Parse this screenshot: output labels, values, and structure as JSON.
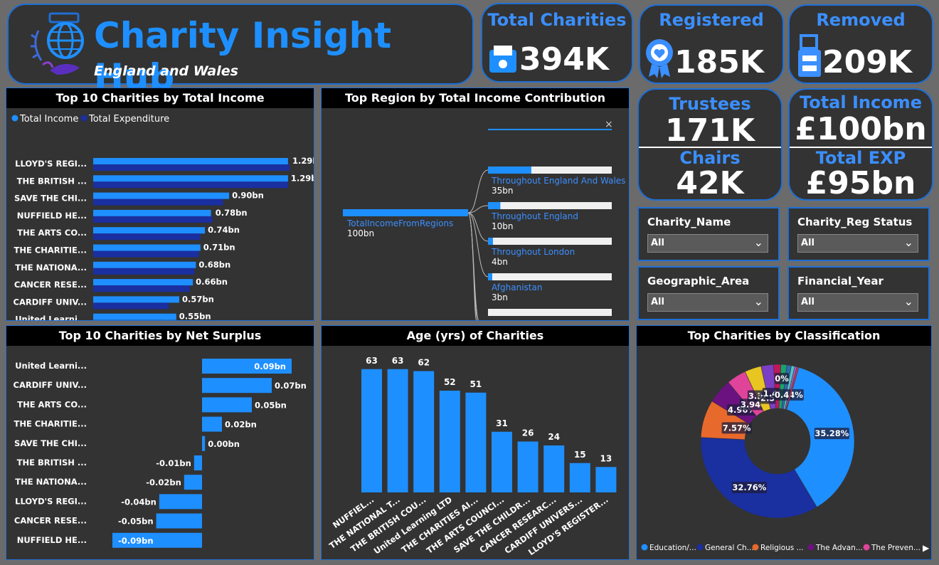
{
  "header": {
    "title": "Charity Insight Hub",
    "subtitle": "England and Wales"
  },
  "kpis": {
    "total_charities": {
      "label": "Total Charities",
      "value": "394K"
    },
    "registered": {
      "label": "Registered",
      "value": "185K"
    },
    "removed": {
      "label": "Removed",
      "value": "209K"
    },
    "trustees": {
      "label": "Trustees",
      "value": "171K"
    },
    "chairs": {
      "label": "Chairs",
      "value": "42K"
    },
    "total_income": {
      "label": "Total Income",
      "value": "£100bn"
    },
    "total_exp": {
      "label": "Total EXP",
      "value": "£95bn"
    }
  },
  "slicers": [
    {
      "label": "Charity_Name",
      "value": "All"
    },
    {
      "label": "Charity_Reg Status",
      "value": "All"
    },
    {
      "label": "Geographic_Area",
      "value": "All"
    },
    {
      "label": "Financial_Year",
      "value": "All"
    }
  ],
  "panels": {
    "income": "Top 10 Charities by Total Income",
    "region": "Top Region by Total Income Contribution",
    "surplus": "Top 10 Charities by Net Surplus",
    "age": "Age (yrs) of Charities",
    "classification": "Top Charities by Classification"
  },
  "colors": {
    "accent": "#1e8fff",
    "navy": "#1a2fa0",
    "panel": "#333333"
  },
  "chart_data": [
    {
      "type": "bar",
      "title": "Top 10 Charities by Total Income",
      "legend": "top-left",
      "categories": [
        "LLOYD'S REGI...",
        "THE BRITISH ...",
        "SAVE THE CHI...",
        "NUFFIELD HE...",
        "THE ARTS CO...",
        "THE CHARITIE...",
        "THE NATIONA...",
        "CANCER RESE...",
        "CARDIFF UNIV...",
        "United Learni..."
      ],
      "series": [
        {
          "name": "Total Income",
          "values": [
            1.29,
            1.29,
            0.9,
            0.78,
            0.74,
            0.71,
            0.68,
            0.66,
            0.57,
            0.55
          ],
          "labels": [
            "1.29bn",
            "1.29bn",
            "0.90bn",
            "0.78bn",
            "0.74bn",
            "0.71bn",
            "0.68bn",
            "0.66bn",
            "0.57bn",
            "0.55bn"
          ]
        },
        {
          "name": "Total Expenditure",
          "values": [
            1.3,
            1.29,
            0.86,
            0.79,
            0.71,
            0.7,
            0.67,
            0.64,
            0.5,
            0.46
          ]
        }
      ]
    },
    {
      "type": "tree",
      "title": "Top Region by Total Income Contribution",
      "root": {
        "name": "TotalIncomeFromRegions",
        "value": 100,
        "label": "100bn"
      },
      "nodes": [
        {
          "name": "Throughout England And Wales",
          "value": 35,
          "label": "35bn"
        },
        {
          "name": "Throughout England",
          "value": 10,
          "label": "10bn"
        },
        {
          "name": "Throughout London",
          "value": 4,
          "label": "4bn"
        },
        {
          "name": "Afghanistan",
          "value": 3,
          "label": "3bn"
        }
      ]
    },
    {
      "type": "bar",
      "title": "Top 10 Charities by Net Surplus",
      "categories": [
        "United Learni...",
        "CARDIFF UNIV...",
        "THE ARTS CO...",
        "THE CHARITIE...",
        "SAVE THE CHI...",
        "THE BRITISH ...",
        "THE NATIONA...",
        "LLOYD'S REGI...",
        "CANCER RESE...",
        "NUFFIELD HE..."
      ],
      "values": [
        0.09,
        0.07,
        0.05,
        0.02,
        0.003,
        -0.008,
        -0.018,
        -0.043,
        -0.046,
        -0.09
      ],
      "labels": [
        "0.09bn",
        "0.07bn",
        "0.05bn",
        "0.02bn",
        "0.00bn",
        "-0.01bn",
        "-0.02bn",
        "-0.04bn",
        "-0.05bn",
        "-0.09bn"
      ]
    },
    {
      "type": "bar",
      "title": "Age (yrs) of Charities",
      "categories": [
        "NUFFIEL...",
        "THE NATIONAL T...",
        "THE BRITISH COU...",
        "United Learning LTD",
        "THE CHARITIES AI...",
        "THE ARTS COUNCI...",
        "SAVE THE CHILDR...",
        "CANCER RESEARC...",
        "CARDIFF UNIVERS...",
        "LLOYD'S REGISTER..."
      ],
      "values": [
        63,
        63,
        62,
        52,
        51,
        31,
        26,
        24,
        15,
        13
      ]
    },
    {
      "type": "pie",
      "title": "Top Charities by Classification",
      "legend": "bottom",
      "slices": [
        {
          "name": "Education/...",
          "value": 35.28,
          "label": "35.28%",
          "color": "#1e8fff"
        },
        {
          "name": "General Ch...",
          "value": 32.76,
          "label": "32.76%",
          "color": "#1a2fa0"
        },
        {
          "name": "Religious ...",
          "value": 7.57,
          "label": "7.57%",
          "color": "#e8692c"
        },
        {
          "name": "The Advan...",
          "value": 4.96,
          "label": "4.96%",
          "color": "#6b1280"
        },
        {
          "name": "The Preven...",
          "value": 3.94,
          "label": "3.94%",
          "color": "#e0449a"
        },
        {
          "name": "",
          "value": 3.35,
          "label": "3.35%",
          "color": "#e8c521"
        },
        {
          "name": "",
          "value": 2.5,
          "label": "2.5%",
          "color": "#7b3fc4"
        },
        {
          "name": "",
          "value": 1.45,
          "label": "1.45%",
          "color": "#c0185b"
        },
        {
          "name": "",
          "value": 1.2,
          "label": "",
          "color": "#1aa36a"
        },
        {
          "name": "",
          "value": 0.9,
          "label": "",
          "color": "#2b6cb0"
        },
        {
          "name": "",
          "value": 0.7,
          "label": "",
          "color": "#4fc3c7"
        },
        {
          "name": "",
          "value": 0.44,
          "label": "0.44%",
          "color": "#a05ccf"
        },
        {
          "name": "",
          "value": 0.35,
          "label": "",
          "color": "#d9365c"
        },
        {
          "name": "",
          "value": 0.0,
          "label": "0%",
          "color": "#9aa0a6"
        }
      ]
    }
  ]
}
